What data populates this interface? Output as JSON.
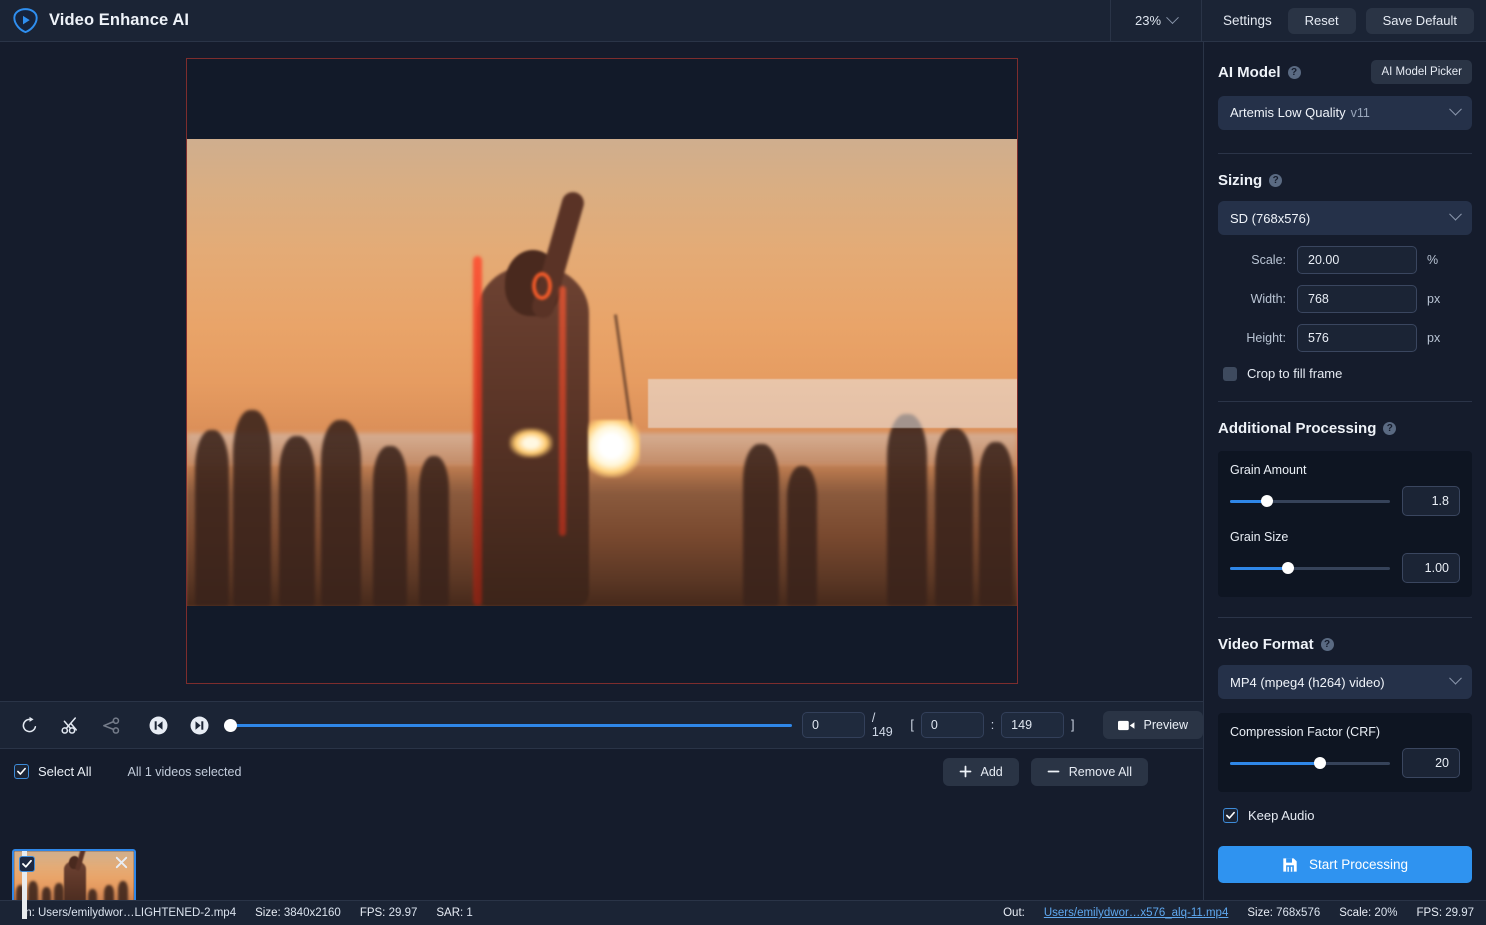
{
  "app": {
    "title": "Video Enhance AI",
    "logo_icon": "play-shield-logo"
  },
  "header": {
    "zoom_level": "23%",
    "zoom_chevron_icon": "chevron-down-icon",
    "settings_label": "Settings",
    "reset_label": "Reset",
    "save_default_label": "Save Default"
  },
  "preview": {
    "crop_overlay_present": true
  },
  "timeline": {
    "icons": [
      "rotate-icon",
      "scissors-icon",
      "scissors-split-icon",
      "skip-start-icon",
      "skip-end-icon"
    ],
    "current_frame": "0",
    "total_frames": "/ 149",
    "bracket_open": "[",
    "range_in": "0",
    "range_sep": ":",
    "range_out": "149",
    "bracket_close": "]",
    "preview_label": "Preview",
    "preview_icon": "video-camera-icon",
    "scrub_percent": 0
  },
  "selection": {
    "select_all_label": "Select All",
    "select_all_checked": true,
    "count_text": "All 1 videos selected",
    "add_label": "Add",
    "add_icon": "plus-icon",
    "remove_all_label": "Remove All",
    "remove_icon": "minus-icon"
  },
  "thumbnail": {
    "checked": true,
    "close_icon": "close-icon"
  },
  "settings": {
    "ai_model": {
      "title": "AI Model",
      "help_icon": "help-icon",
      "picker_label": "AI Model Picker",
      "selected": "Artemis Low Quality",
      "version": "v11",
      "chevron_icon": "chevron-down-icon"
    },
    "sizing": {
      "title": "Sizing",
      "help_icon": "help-icon",
      "preset": "SD (768x576)",
      "chevron_icon": "chevron-down-icon",
      "scale_label": "Scale:",
      "scale_value": "20.00",
      "scale_unit": "%",
      "width_label": "Width:",
      "width_value": "768",
      "width_unit": "px",
      "height_label": "Height:",
      "height_value": "576",
      "height_unit": "px",
      "crop_label": "Crop to fill frame",
      "crop_checked": false
    },
    "additional_processing": {
      "title": "Additional Processing",
      "help_icon": "help-icon",
      "grain_amount_label": "Grain Amount",
      "grain_amount_value": "1.8",
      "grain_amount_percent": 23,
      "grain_size_label": "Grain Size",
      "grain_size_value": "1.00",
      "grain_size_percent": 36
    },
    "video_format": {
      "title": "Video Format",
      "help_icon": "help-icon",
      "selected": "MP4 (mpeg4 (h264) video)",
      "chevron_icon": "chevron-down-icon",
      "crf_label": "Compression Factor (CRF)",
      "crf_value": "20",
      "crf_percent": 56,
      "keep_audio_label": "Keep Audio",
      "keep_audio_checked": true
    },
    "start_processing_label": "Start Processing",
    "start_processing_icon": "save-icon"
  },
  "statusbar": {
    "in_key": "In:",
    "in_path": "Users/emilydwor…LIGHTENED-2.mp4",
    "in_size_label": "Size:",
    "in_size": "3840x2160",
    "in_fps_label": "FPS:",
    "in_fps": "29.97",
    "in_sar_label": "SAR:",
    "in_sar": "1",
    "out_key": "Out:",
    "out_path": "Users/emilydwor…x576_alq-11.mp4",
    "out_size_label": "Size:",
    "out_size": "768x576",
    "out_scale_label": "Scale:",
    "out_scale": "20%",
    "out_fps_label": "FPS:",
    "out_fps": "29.97"
  }
}
